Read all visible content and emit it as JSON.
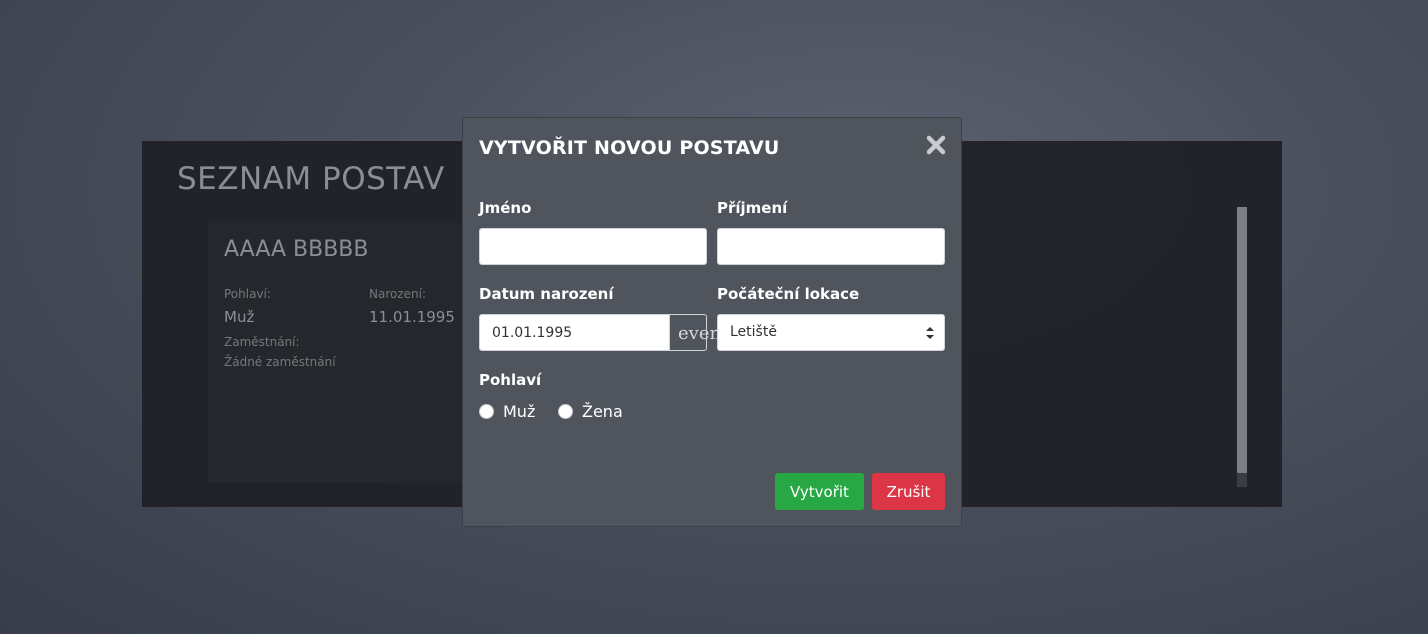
{
  "background_panel": {
    "title": "SEZNAM POSTAV",
    "character": {
      "name": "AAAA BBBBB",
      "gender_label": "Pohlaví:",
      "gender_value": "Muž",
      "birth_label": "Narození:",
      "birth_value": "11.01.1995",
      "job_label": "Zaměstnání:",
      "job_value": "Žádné zaměstnání"
    }
  },
  "modal": {
    "title": "VYTVOŘIT NOVOU POSTAVU",
    "close_icon": "close-icon",
    "first_name": {
      "label": "Jméno",
      "value": ""
    },
    "last_name": {
      "label": "Příjmení",
      "value": ""
    },
    "birth_date": {
      "label": "Datum narození",
      "value": "01.01.1995",
      "addon_text": "event"
    },
    "start_location": {
      "label": "Počáteční lokace",
      "selected": "Letiště"
    },
    "gender": {
      "label": "Pohlaví",
      "options": [
        "Muž",
        "Žena"
      ]
    },
    "buttons": {
      "create": "Vytvořit",
      "cancel": "Zrušit"
    }
  },
  "colors": {
    "modal_bg": "#50555d",
    "create": "#28a745",
    "cancel": "#dc3545"
  }
}
